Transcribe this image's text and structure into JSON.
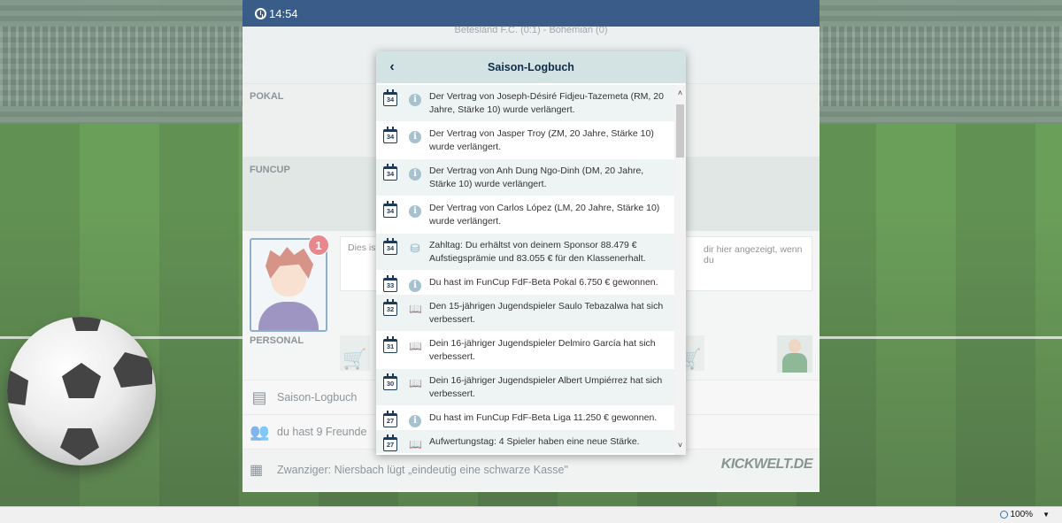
{
  "topbar": {
    "time": "14:54"
  },
  "match": {
    "score_text": "Betesland F.C. (0:1) - Bohemian (0)"
  },
  "sections": {
    "pokal": "POKAL",
    "funcup": "FUNCUP",
    "personal": "PERSONAL"
  },
  "notification": {
    "badge": "1",
    "text_left": "Dies ist eine Se",
    "text_right": "dir hier angezeigt, wenn du"
  },
  "menu": {
    "logbook": "Saison-Logbuch",
    "friends": "du hast 9 Freunde",
    "news": "Zwanziger: Niersbach lügt  „eindeutig eine schwarze Kasse\"",
    "logo": "KICKWELT.DE"
  },
  "modal": {
    "title": "Saison-Logbuch",
    "back_icon": "chevron-left",
    "entries": [
      {
        "day": "34",
        "type": "info",
        "text": "Der Vertrag von Joseph-Désiré Fidjeu-Tazemeta (RM, 20 Jahre, Stärke 10) wurde verlängert."
      },
      {
        "day": "34",
        "type": "info",
        "text": "Der Vertrag von Jasper Troy (ZM, 20 Jahre, Stärke 10) wurde verlängert."
      },
      {
        "day": "34",
        "type": "info",
        "text": "Der Vertrag von Anh Dung Ngo-Dinh (DM, 20 Jahre, Stärke 10) wurde verlängert."
      },
      {
        "day": "34",
        "type": "info",
        "text": "Der Vertrag von Carlos López (LM, 20 Jahre, Stärke 10) wurde verlängert."
      },
      {
        "day": "34",
        "type": "money",
        "text": "Zahltag: Du erhältst von deinem Sponsor 88.479 € Aufstiegsprämie und 83.055 € für den Klassenerhalt."
      },
      {
        "day": "33",
        "type": "info",
        "text": "Du hast im FunCup FdF-Beta Pokal 6.750 € gewonnen."
      },
      {
        "day": "32",
        "type": "book",
        "text": "Den 15-jährigen Jugendspieler Saulo Tebazalwa hat sich verbessert."
      },
      {
        "day": "31",
        "type": "book",
        "text": "Dein 16-jähriger Jugendspieler Delmiro García hat sich verbessert."
      },
      {
        "day": "30",
        "type": "book",
        "text": "Dein 16-jähriger Jugendspieler Albert Umpiérrez hat sich verbessert."
      },
      {
        "day": "27",
        "type": "info",
        "text": "Du hast im FunCup FdF-Beta Liga 11.250 € gewonnen."
      },
      {
        "day": "27",
        "type": "book",
        "text": "Aufwertungstag: 4 Spieler haben eine neue Stärke."
      }
    ]
  },
  "statusbar": {
    "zoom": "100%"
  }
}
